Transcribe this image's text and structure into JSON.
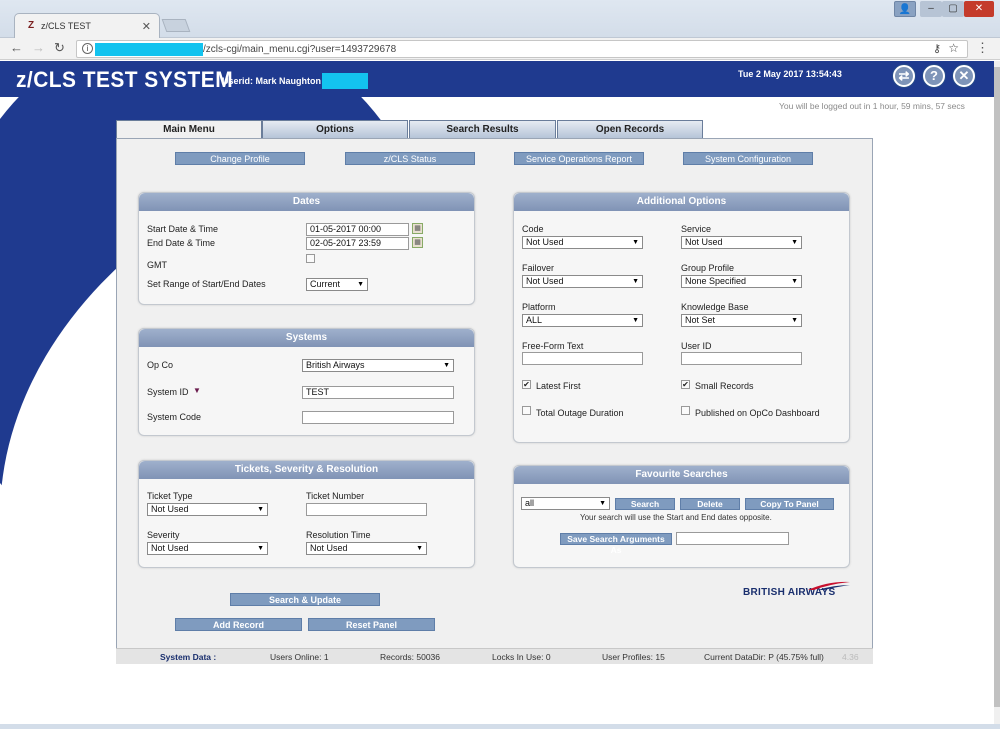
{
  "browser": {
    "tab_title": "z/CLS TEST",
    "tab_favicon": "Z",
    "url_tail": "/zcls-cgi/main_menu.cgi?user=1493729678"
  },
  "header": {
    "system_title": "z/CLS TEST SYSTEM",
    "userid": "Userid: Mark Naughton",
    "datetime": "Tue 2 May 2017 13:54:43",
    "logout_msg": "You will be logged out in 1 hour, 59 mins, 57 secs"
  },
  "tabs": [
    "Main Menu",
    "Options",
    "Search Results",
    "Open Records"
  ],
  "top_buttons": [
    "Change Profile",
    "z/CLS Status",
    "Service Operations Report",
    "System Configuration"
  ],
  "dates": {
    "title": "Dates",
    "start_label": "Start Date & Time",
    "start_value": "01-05-2017 00:00",
    "end_label": "End Date & Time",
    "end_value": "02-05-2017 23:59",
    "gmt_label": "GMT",
    "range_label": "Set Range of Start/End Dates",
    "range_value": "Current"
  },
  "systems": {
    "title": "Systems",
    "opco_label": "Op Co",
    "opco_value": "British Airways",
    "sysid_label": "System ID",
    "sysid_value": "TEST",
    "syscode_label": "System Code",
    "syscode_value": ""
  },
  "tickets": {
    "title": "Tickets, Severity & Resolution",
    "type_label": "Ticket Type",
    "type_value": "Not Used",
    "number_label": "Ticket Number",
    "number_value": "",
    "severity_label": "Severity",
    "severity_value": "Not Used",
    "restime_label": "Resolution Time",
    "restime_value": "Not Used"
  },
  "additional": {
    "title": "Additional Options",
    "code_label": "Code",
    "code_value": "Not Used",
    "service_label": "Service",
    "service_value": "Not Used",
    "failover_label": "Failover",
    "failover_value": "Not Used",
    "group_label": "Group Profile",
    "group_value": "None Specified",
    "platform_label": "Platform",
    "platform_value": "ALL",
    "kb_label": "Knowledge Base",
    "kb_value": "Not Set",
    "freeform_label": "Free-Form Text",
    "userid_label": "User ID",
    "latest_first": "Latest First",
    "small_records": "Small Records",
    "total_outage": "Total Outage Duration",
    "published": "Published on OpCo Dashboard"
  },
  "favourites": {
    "title": "Favourite Searches",
    "select_value": "all",
    "search_btn": "Search",
    "delete_btn": "Delete",
    "copy_btn": "Copy To Panel",
    "note": "Your search will use the Start and End dates opposite.",
    "save_btn": "Save Search Arguments As"
  },
  "actions": {
    "search_update": "Search & Update",
    "add_record": "Add Record",
    "reset_panel": "Reset Panel"
  },
  "brand": {
    "logo_text": "BRITISH AIRWAYS"
  },
  "status": {
    "label": "System Data :",
    "users_online": "Users Online: 1",
    "records": "Records: 50036",
    "locks": "Locks In Use: 0",
    "profiles": "User Profiles: 15",
    "datadir": "Current DataDir: P (45.75% full)",
    "version": "4.36"
  }
}
